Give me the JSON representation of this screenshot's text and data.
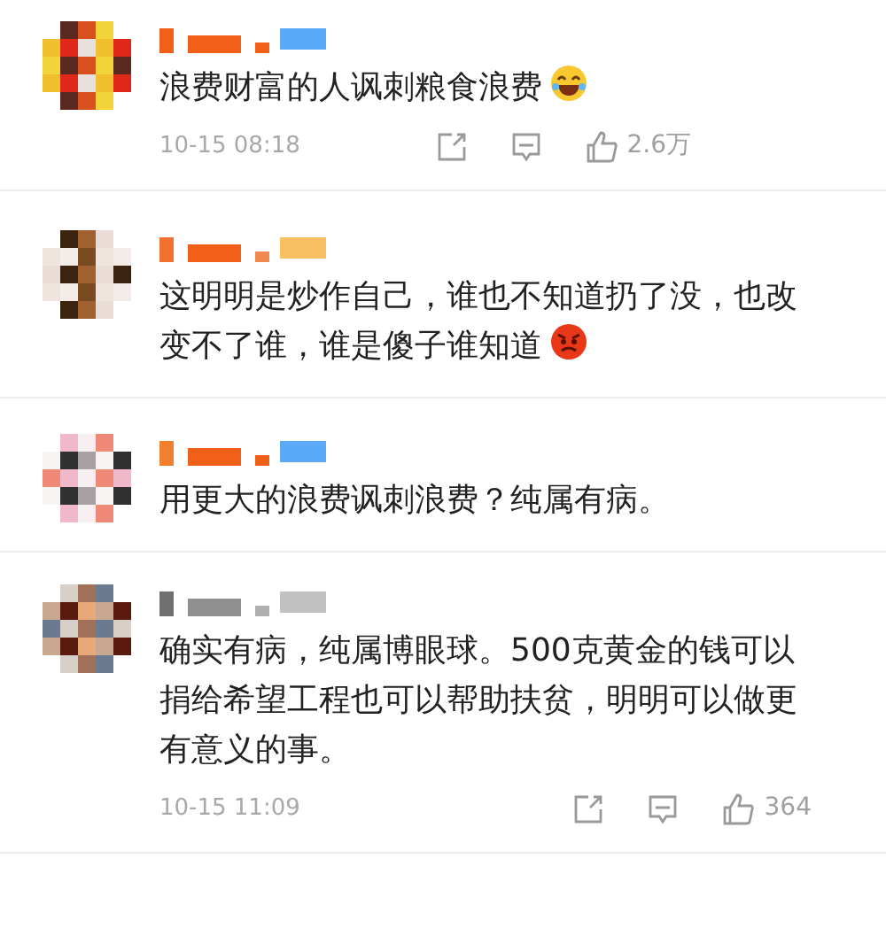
{
  "comments": [
    {
      "text": "浪费财富的人讽刺粮食浪费",
      "emoji": {
        "kind": "laugh"
      },
      "time": "10-15 08:18",
      "likes": "2.6万"
    },
    {
      "text": "这明明是炒作自己，谁也不知道扔了没，也改变不了谁，谁是傻子谁知道",
      "emoji": {
        "kind": "angry"
      }
    },
    {
      "text": "用更大的浪费讽刺浪费？纯属有病。"
    },
    {
      "text": "确实有病，纯属博眼球。500克黄金的钱可以捐给希望工程也可以帮助扶贫，明明可以做更有意义的事。",
      "time": "10-15 11:09",
      "likes": "364"
    }
  ]
}
